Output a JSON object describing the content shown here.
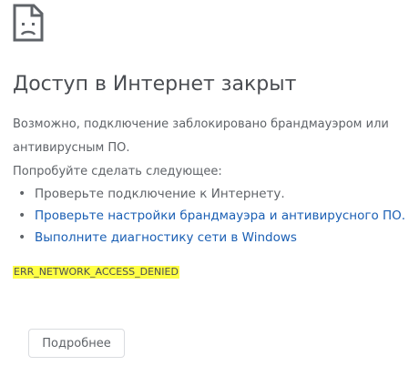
{
  "icon": {
    "name": "sad-document-icon"
  },
  "headline": "Доступ в Интернет закрыт",
  "message": "Возможно, подключение заблокировано брандмауэром или антивирусным ПО.",
  "suggestions": {
    "title": "Попробуйте сделать следующее:",
    "items": [
      {
        "label": "Проверьте подключение к Интернету.",
        "is_link": false
      },
      {
        "label": "Проверьте настройки брандмауэра и антивирусного ПО.",
        "is_link": true
      },
      {
        "label": "Выполните диагностику сети в Windows",
        "is_link": true
      }
    ]
  },
  "error_code": "ERR_NETWORK_ACCESS_DENIED",
  "details_button": "Подробнее",
  "colors": {
    "text": "#5f6368",
    "headline": "#4a4d52",
    "link": "#1a5fb4",
    "highlight": "#ffff44"
  }
}
